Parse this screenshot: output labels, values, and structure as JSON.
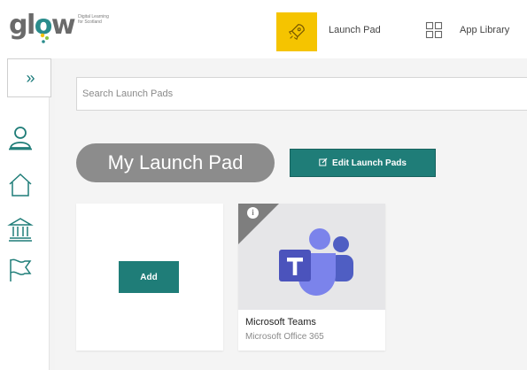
{
  "header": {
    "logo_text": "glow",
    "logo_tagline_1": "Digital Learning",
    "logo_tagline_2": "for Scotland",
    "launch_pad_label": "Launch Pad",
    "app_library_label": "App Library"
  },
  "colors": {
    "teal": "#1f7d78",
    "yellow": "#f5c400",
    "pill_gray": "#8c8c8c"
  },
  "rail": {
    "expand_glyph": "»",
    "icons": [
      "user-icon",
      "home-icon",
      "institution-icon",
      "flag-icon"
    ]
  },
  "search": {
    "placeholder": "Search Launch Pads",
    "value": ""
  },
  "main": {
    "title": "My Launch Pad",
    "edit_label": "Edit Launch Pads"
  },
  "cards": {
    "add_label": "Add",
    "app_tile": {
      "name": "Microsoft Teams",
      "publisher": "Microsoft Office 365",
      "icon": "teams-icon",
      "info_glyph": "i"
    }
  }
}
